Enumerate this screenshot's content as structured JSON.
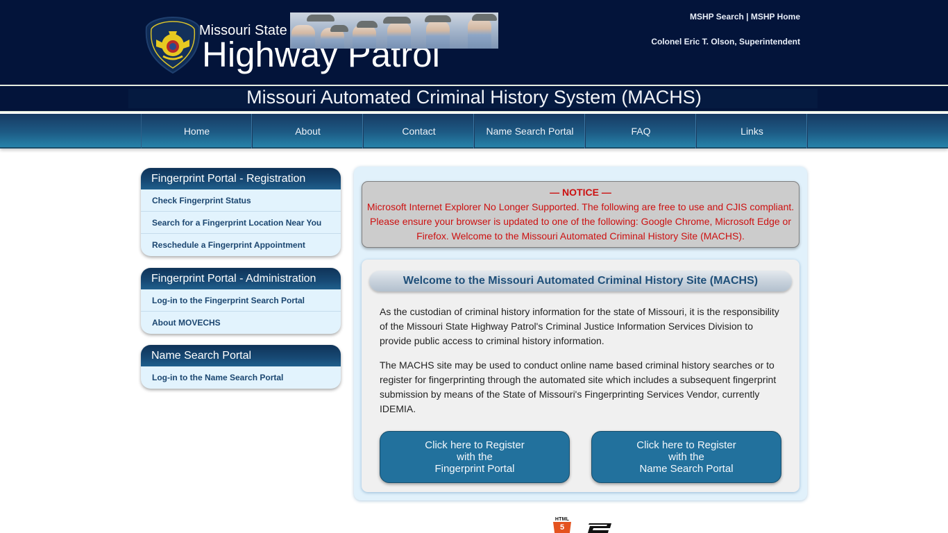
{
  "header": {
    "logo_small": "Missouri State",
    "logo_big": "Highway Patrol",
    "top_links": [
      {
        "label": "MSHP Search"
      },
      {
        "label": "MSHP Home"
      }
    ],
    "top_links_separator": " | ",
    "superintendent": "Colonel Eric T. Olson, Superintendent",
    "badge_icon": "highway-patrol-badge",
    "banner_image": "troopers-saluting-photo"
  },
  "site_title": "Missouri Automated Criminal History System (MACHS)",
  "nav": {
    "items": [
      {
        "label": "Home"
      },
      {
        "label": "About"
      },
      {
        "label": "Contact"
      },
      {
        "label": "Name Search Portal"
      },
      {
        "label": "FAQ"
      },
      {
        "label": "Links"
      }
    ]
  },
  "sidebar": {
    "panels": [
      {
        "title": "Fingerprint Portal - Registration",
        "links": [
          {
            "label": "Check Fingerprint Status"
          },
          {
            "label": "Search for a Fingerprint Location Near You"
          },
          {
            "label": "Reschedule a Fingerprint Appointment"
          }
        ]
      },
      {
        "title": "Fingerprint Portal - Administration",
        "links": [
          {
            "label": "Log-in to the Fingerprint Search Portal"
          },
          {
            "label": "About MOVECHS"
          }
        ]
      },
      {
        "title": "Name Search Portal",
        "links": [
          {
            "label": "Log-in to the Name Search Portal"
          }
        ]
      }
    ]
  },
  "notice": {
    "title": "— NOTICE —",
    "body": "Microsoft Internet Explorer No Longer Supported. The following are free to use and CJIS compliant. Please ensure your browser is updated to one of the following: Google Chrome, Microsoft Edge or Firefox. Welcome to the Missouri Automated Criminal History Site (MACHS).",
    "color": "#cc1010"
  },
  "welcome": {
    "heading": "Welcome to the Missouri Automated Criminal History Site (MACHS)",
    "paragraphs": [
      "As the custodian of criminal history information for the state of Missouri, it is the responsibility of the Missouri State Highway Patrol's Criminal Justice Information Services Division to provide public access to criminal history information.",
      "The MACHS site may be used to conduct online name based criminal history searches or to register for fingerprinting through the automated site which includes a subsequent fingerprint submission by means of the State of Missouri's Fingerprinting Services Vendor, currently IDEMIA."
    ],
    "buttons": [
      {
        "line1": "Click here to Register",
        "line2": "with the",
        "line3": "Fingerprint Portal"
      },
      {
        "line1": "Click here to Register",
        "line2": "with the",
        "line3": "Name Search Portal"
      }
    ]
  },
  "footer": {
    "html5_label": "HTML",
    "html5_number": "5",
    "badges": [
      "html5-icon",
      "css3-icon"
    ]
  },
  "colors": {
    "header_bg": "#03143a",
    "nav_accent": "#2683aa",
    "panel_bg": "#e2f3fd",
    "link_text": "#1b4670",
    "button_bg": "#22719d"
  }
}
